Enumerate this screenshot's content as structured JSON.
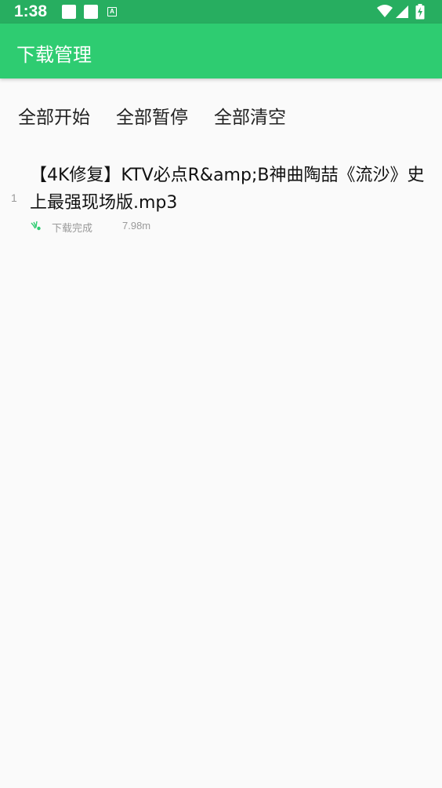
{
  "status_bar": {
    "time": "1:38",
    "notification_icons": [
      "square-notification-icon",
      "square-notification-icon",
      "a-notification-icon"
    ],
    "notif_a_letter": "A",
    "system_icons": [
      "wifi-icon",
      "signal-icon",
      "battery-charging-icon"
    ]
  },
  "app_bar": {
    "title": "下载管理",
    "color": "#2ecc71"
  },
  "actions": {
    "start_all": "全部开始",
    "pause_all": "全部暂停",
    "clear_all": "全部清空"
  },
  "downloads": [
    {
      "index": "1",
      "name": "【4K修复】KTV必点R&amp;B神曲陶喆《流沙》史上最强现场版.mp3",
      "status": "下载完成",
      "size": "7.98m",
      "status_icon": "download-complete-icon"
    }
  ]
}
